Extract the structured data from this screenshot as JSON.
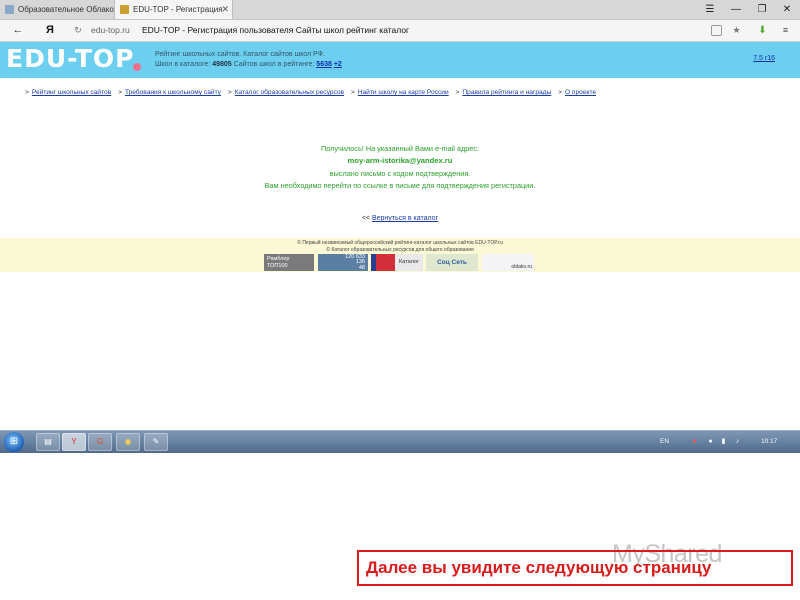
{
  "browser": {
    "tabs": [
      {
        "title": "Образовательное Облако"
      },
      {
        "title": "EDU-TOP - Регистрация"
      }
    ],
    "menu_icon": "hamburger-icon",
    "minimize_icon": "minimize-icon",
    "restore_icon": "restore-icon",
    "close_icon": "close-icon",
    "back_icon": "back-arrow-icon",
    "yandex_button": "Я",
    "url_domain": "edu-top.ru",
    "url_title": "EDU-TOP - Регистрация пользователя Сайты школ рейтинг каталог",
    "bookmark_icon": "star-icon",
    "download_icon": "download-icon"
  },
  "site": {
    "logo": "EDU-TOP",
    "header_line1": "Рейтинг школьных сайтов. Каталог сайтов школ РФ.",
    "header_line2_prefix": "Школ в каталоге: ",
    "schools_in_catalog": "49805",
    "header_line2_mid": " Сайтов школ в рейтинге: ",
    "schools_in_rating": "5638",
    "rating_delta": "+2",
    "version": "7.5 r16",
    "nav": [
      "Рейтинг школьных сайтов",
      "Требования к школьному сайту",
      "Каталог образовательных ресурсов",
      "Найти школу на карте России",
      "Правила рейтинга и награды",
      "О проекте"
    ],
    "nav_separator": ">"
  },
  "message": {
    "line1": "Получилось! На указанный Вами e-mail адрес:",
    "email": "moy-arm-istorika@yandex.ru",
    "line3": "выслано письмо с кодом подтверждения.",
    "line4": "Вам необходимо перейти по ссылке в письме для подтверждения регистрации.",
    "back_prefix": "<< ",
    "back_link": "Вернуться в каталог"
  },
  "footer": {
    "line1": "© Первый независимый общероссийский рейтинг-каталог школьных сайтов EDU-TOP.ru",
    "line2": "© Каталог образовательных ресурсов для общего образования",
    "badge_rambler_1": "Рамблер",
    "badge_rambler_2": "ТОП100",
    "badge_li_1": "120 633",
    "badge_li_2": "136",
    "badge_li_3": "48",
    "badge_catalog": "Каталог",
    "badge_social": "Соц  Сеть",
    "badge_oblako": "oblako.ru"
  },
  "taskbar": {
    "start_icon": "windows-start-icon",
    "apps": [
      "explorer-icon",
      "yandex-browser-icon",
      "chrome-icon",
      "media-icon",
      "notepad-icon"
    ],
    "app_glyphs": [
      "▤",
      "Y",
      "G",
      "◉",
      "✎"
    ],
    "language": "EN",
    "clock": "10:17"
  },
  "overlay": {
    "watermark": "MyShared",
    "caption": "Далее вы увидите следующую страницу"
  },
  "colors": {
    "header_bg": "#6ccff0",
    "message_green": "#2ca02c",
    "link_blue": "#1a3ea0",
    "footer_bg": "#fbf8d6",
    "caption_red": "#d81b1b"
  }
}
